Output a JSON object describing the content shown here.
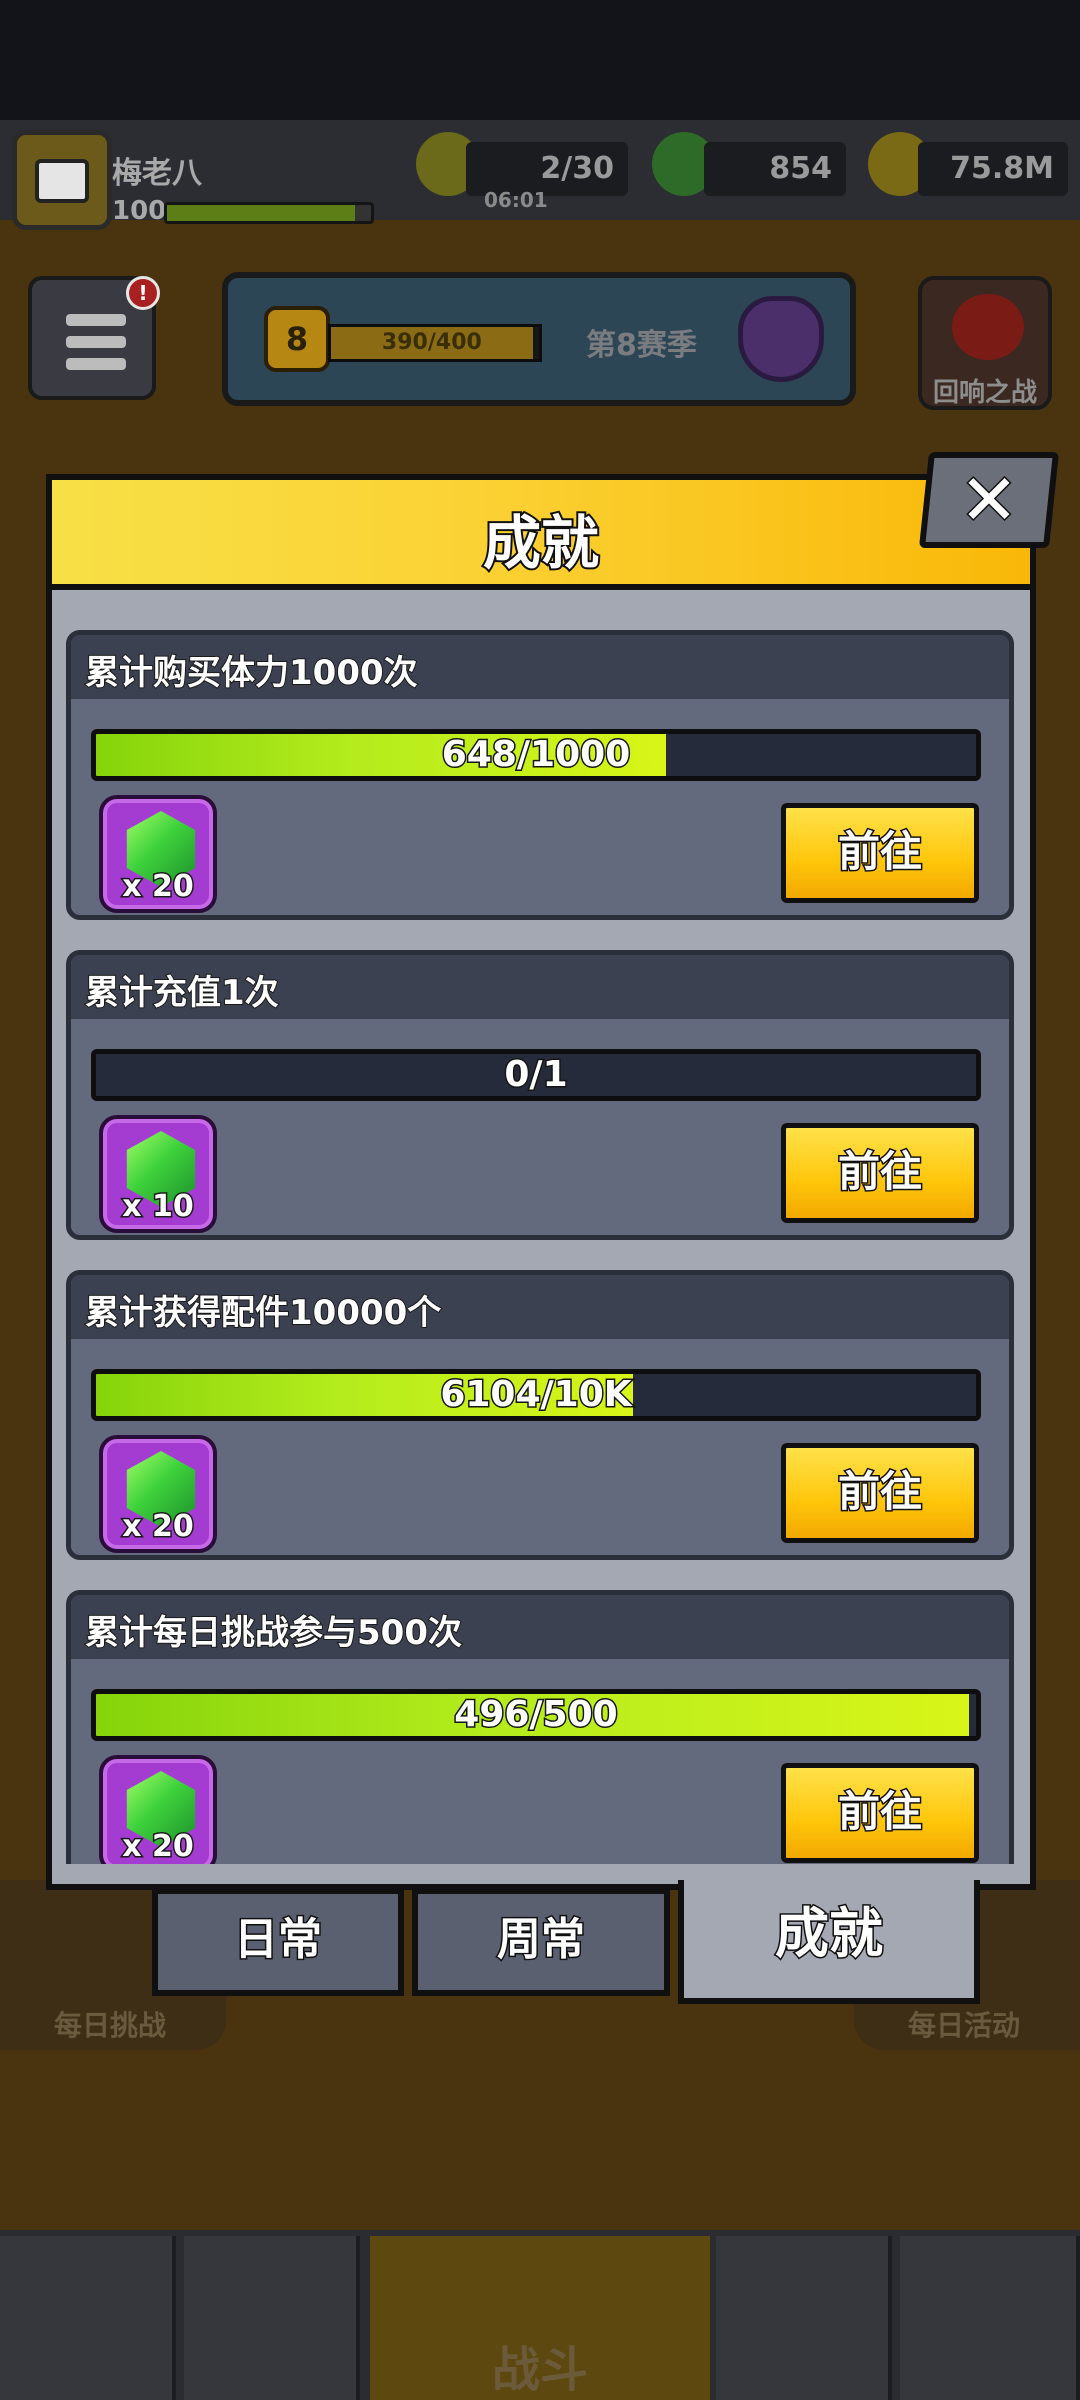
{
  "player": {
    "name": "梅老八",
    "level": "100"
  },
  "resources": {
    "energy": "2/30",
    "energy_timer": "06:01",
    "gems": "854",
    "coins": "75.8M"
  },
  "season": {
    "level": "8",
    "progress": "390/400",
    "label": "第8赛季"
  },
  "echo_battle_label": "回响之战",
  "menu_badge": "!",
  "side_buttons": {
    "left": "每日挑战",
    "right": "每日活动"
  },
  "bottom_nav": {
    "battle": "战斗"
  },
  "modal": {
    "title": "成就",
    "close": "✕",
    "achievements": [
      {
        "title": "累计购买体力1000次",
        "progress_text": "648/1000",
        "progress": 0.648,
        "reward_qty": "x 20",
        "button": "前往"
      },
      {
        "title": "累计充值1次",
        "progress_text": "0/1",
        "progress": 0.0,
        "reward_qty": "x 10",
        "button": "前往"
      },
      {
        "title": "累计获得配件10000个",
        "progress_text": "6104/10K",
        "progress": 0.6104,
        "reward_qty": "x 20",
        "button": "前往"
      },
      {
        "title": "累计每日挑战参与500次",
        "progress_text": "496/500",
        "progress": 0.992,
        "reward_qty": "x 20",
        "button": "前往"
      }
    ],
    "tabs": [
      {
        "label": "日常",
        "active": false
      },
      {
        "label": "周常",
        "active": false
      },
      {
        "label": "成就",
        "active": true
      }
    ]
  }
}
